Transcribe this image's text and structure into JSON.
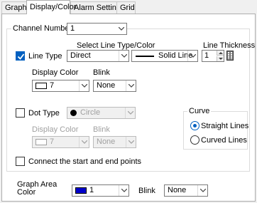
{
  "tabs": [
    {
      "label": "Graph"
    },
    {
      "label": "Display/Color"
    },
    {
      "label": "Alarm Settings"
    },
    {
      "label": "Grid"
    }
  ],
  "channel": {
    "label": "Channel Number",
    "value": "1"
  },
  "line_type": {
    "checkbox_label": "Line Type",
    "checked": true,
    "select_label": "Select Line Type/Color",
    "type_value": "Direct",
    "style_value": "Solid Line",
    "thickness_label": "Line Thickness",
    "thickness_value": "1",
    "display_color_label": "Display Color",
    "display_color_value": "7",
    "display_color_swatch": "#ffffff",
    "blink_label": "Blink",
    "blink_value": "None"
  },
  "dot_type": {
    "checkbox_label": "Dot Type",
    "checked": false,
    "shape_value": "Circle",
    "display_color_label": "Display Color",
    "display_color_value": "7",
    "blink_label": "Blink",
    "blink_value": "None"
  },
  "curve": {
    "title": "Curve",
    "options": [
      {
        "label": "Straight Lines",
        "selected": true
      },
      {
        "label": "Curved Lines",
        "selected": false
      }
    ]
  },
  "connect": {
    "label": "Connect the start and end points",
    "checked": false
  },
  "graph_area": {
    "label_line1": "Graph Area",
    "label_line2": "Color",
    "color_value": "1",
    "color_swatch": "#0000cc",
    "blink_label": "Blink",
    "blink_value": "None"
  },
  "colors": {
    "accent": "#0060c0",
    "tab_active_bg": "#ffffff",
    "window_bg": "#f0f0f0"
  }
}
